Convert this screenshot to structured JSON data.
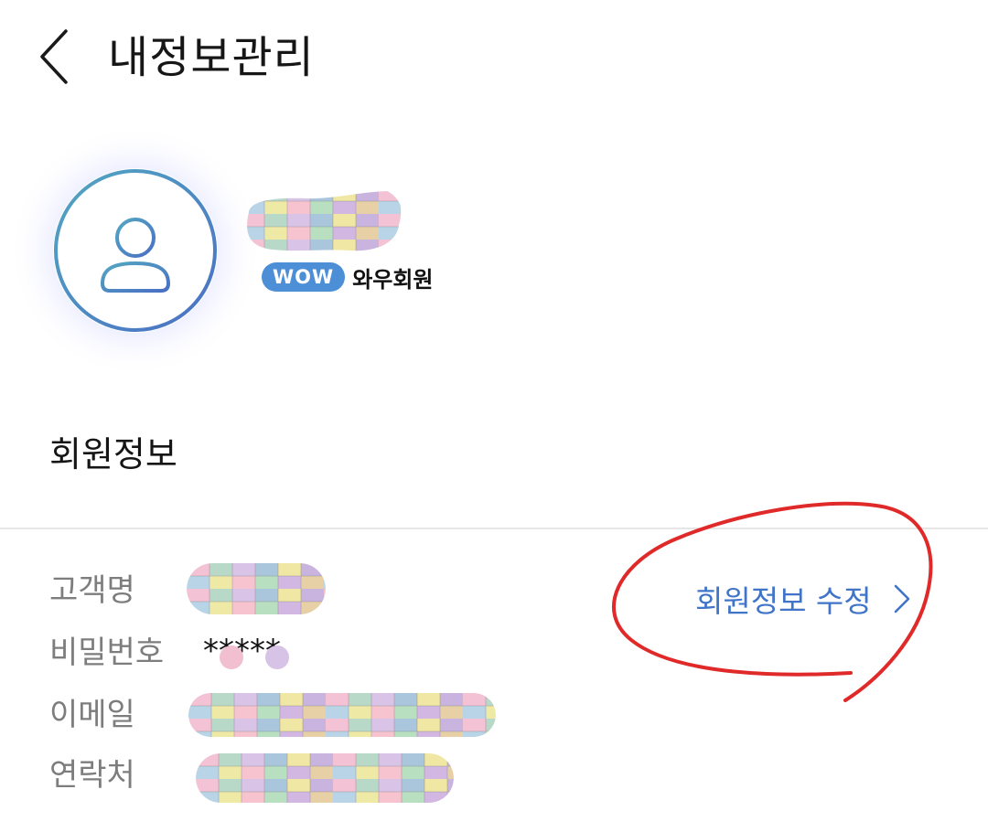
{
  "header": {
    "back_icon": "chevron-left-icon",
    "title": "내정보관리"
  },
  "profile": {
    "avatar_icon": "user-avatar-icon",
    "name_redacted": true,
    "membership_badge": "WOW",
    "membership_label": "와우회원"
  },
  "member_info": {
    "section_title": "회원정보",
    "fields": [
      {
        "label": "고객명",
        "value_redacted": true
      },
      {
        "label": "비밀번호",
        "value": "*****"
      },
      {
        "label": "이메일",
        "value_redacted": true
      },
      {
        "label": "연락처",
        "value_redacted": true
      }
    ],
    "edit_link": "회원정보 수정",
    "edit_icon": "chevron-right-icon"
  },
  "colors": {
    "accent": "#3f74c8",
    "badge": "#4d8fd7",
    "avatar_ring": "#4a8fc0",
    "annotation": "#e02a2a",
    "label": "#7d7d7d"
  }
}
